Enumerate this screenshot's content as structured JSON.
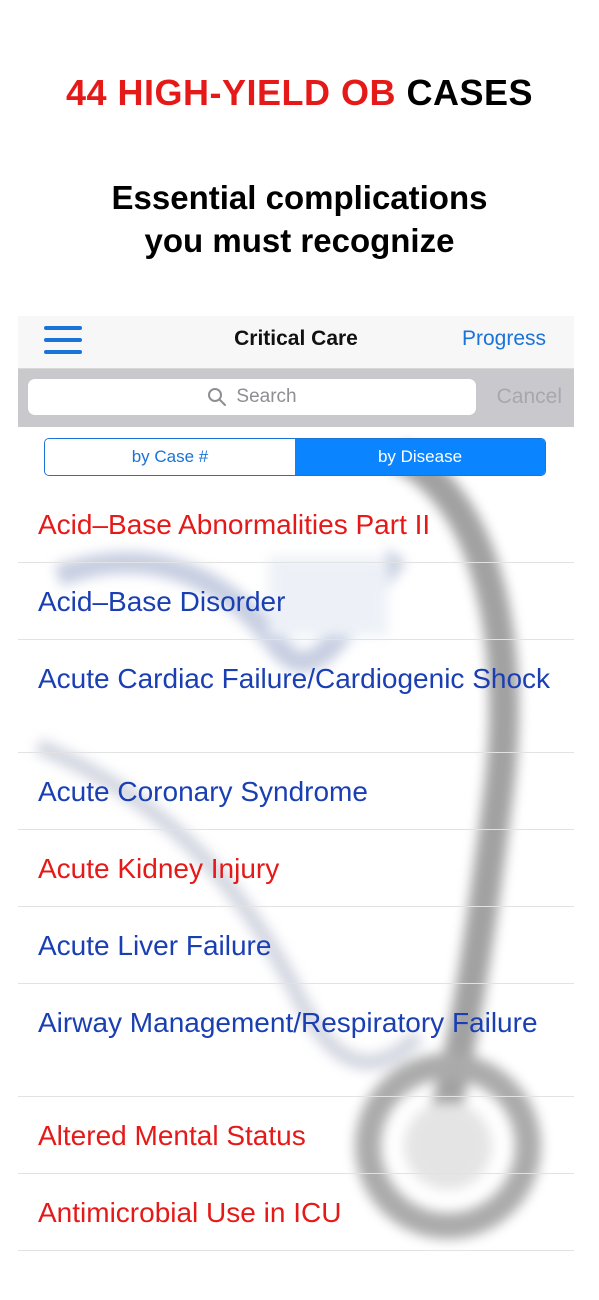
{
  "headline": {
    "red_part": "44 HIGH-YIELD OB",
    "black_part": "CASES"
  },
  "subhead": {
    "line1": "Essential complications",
    "line2": "you must recognize"
  },
  "navbar": {
    "menu_icon": "hamburger-icon",
    "title": "Critical Care",
    "progress_label": "Progress"
  },
  "search": {
    "placeholder": "Search",
    "icon": "search-icon",
    "cancel_label": "Cancel"
  },
  "segmented": {
    "options": [
      "by Case #",
      "by Disease"
    ],
    "selected": "by Disease"
  },
  "colors": {
    "accent_blue": "#1a73d9",
    "item_blue": "#1a3fb3",
    "item_red": "#e61919",
    "headline_red": "#e61919"
  },
  "list": {
    "items": [
      {
        "label": "Acid–Base Abnormalities Part II",
        "color": "red"
      },
      {
        "label": "Acid–Base Disorder",
        "color": "blue"
      },
      {
        "label": "Acute Cardiac Failure/Cardiogenic Shock",
        "color": "blue"
      },
      {
        "label": "Acute Coronary Syndrome",
        "color": "blue"
      },
      {
        "label": "Acute Kidney Injury",
        "color": "red"
      },
      {
        "label": "Acute Liver Failure",
        "color": "blue"
      },
      {
        "label": "Airway Management/Respiratory Failure",
        "color": "blue"
      },
      {
        "label": "Altered Mental Status",
        "color": "red"
      },
      {
        "label": "Antimicrobial Use in ICU",
        "color": "red"
      }
    ]
  }
}
